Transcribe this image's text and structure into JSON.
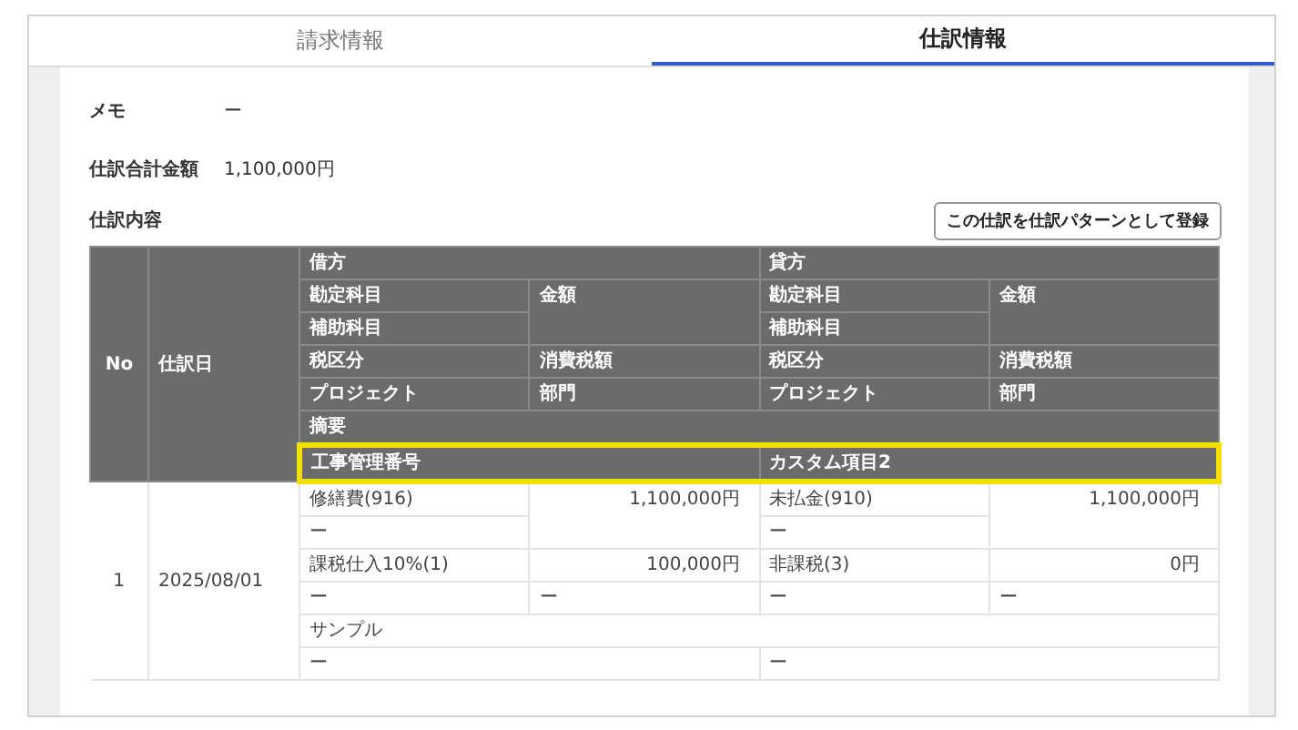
{
  "tabs": [
    {
      "label": "請求情報",
      "selected": false
    },
    {
      "label": "仕訳情報",
      "selected": true
    }
  ],
  "fields": [
    {
      "label": "メモ",
      "value": "ー"
    },
    {
      "label": "仕訳合計金額",
      "value": "1,100,000円"
    }
  ],
  "section": {
    "title": "仕訳内容",
    "button": "この仕訳を仕訳パターンとして登録"
  },
  "table": {
    "no": "No",
    "date": "仕訳日",
    "sides": [
      {
        "label": "借方",
        "account": "勘定科目",
        "amount": "金額",
        "sub_account": "補助科目",
        "tax_category": "税区分",
        "tax_amount": "消費税額",
        "project": "プロジェクト",
        "department": "部門"
      },
      {
        "label": "貸方",
        "account": "勘定科目",
        "amount": "金額",
        "sub_account": "補助科目",
        "tax_category": "税区分",
        "tax_amount": "消費税額",
        "project": "プロジェクト",
        "department": "部門"
      }
    ],
    "memo": "摘要",
    "custom": [
      "工事管理番号",
      "カスタム項目2"
    ],
    "custom_highlighted": true,
    "rows": [
      {
        "no": "1",
        "date": "2025/08/01",
        "entries": [
          {
            "account": "修繕費(916)",
            "amount": "1,100,000円",
            "sub_account": "ー",
            "tax_category": "課税仕入10%(1)",
            "tax_amount": "100,000円",
            "project": "ー",
            "department": "ー"
          },
          {
            "account": "未払金(910)",
            "amount": "1,100,000円",
            "sub_account": "ー",
            "tax_category": "非課税(3)",
            "tax_amount": "0円",
            "project": "ー",
            "department": "ー"
          }
        ],
        "memo": "サンプル",
        "custom": [
          "ー",
          "ー"
        ]
      }
    ]
  }
}
